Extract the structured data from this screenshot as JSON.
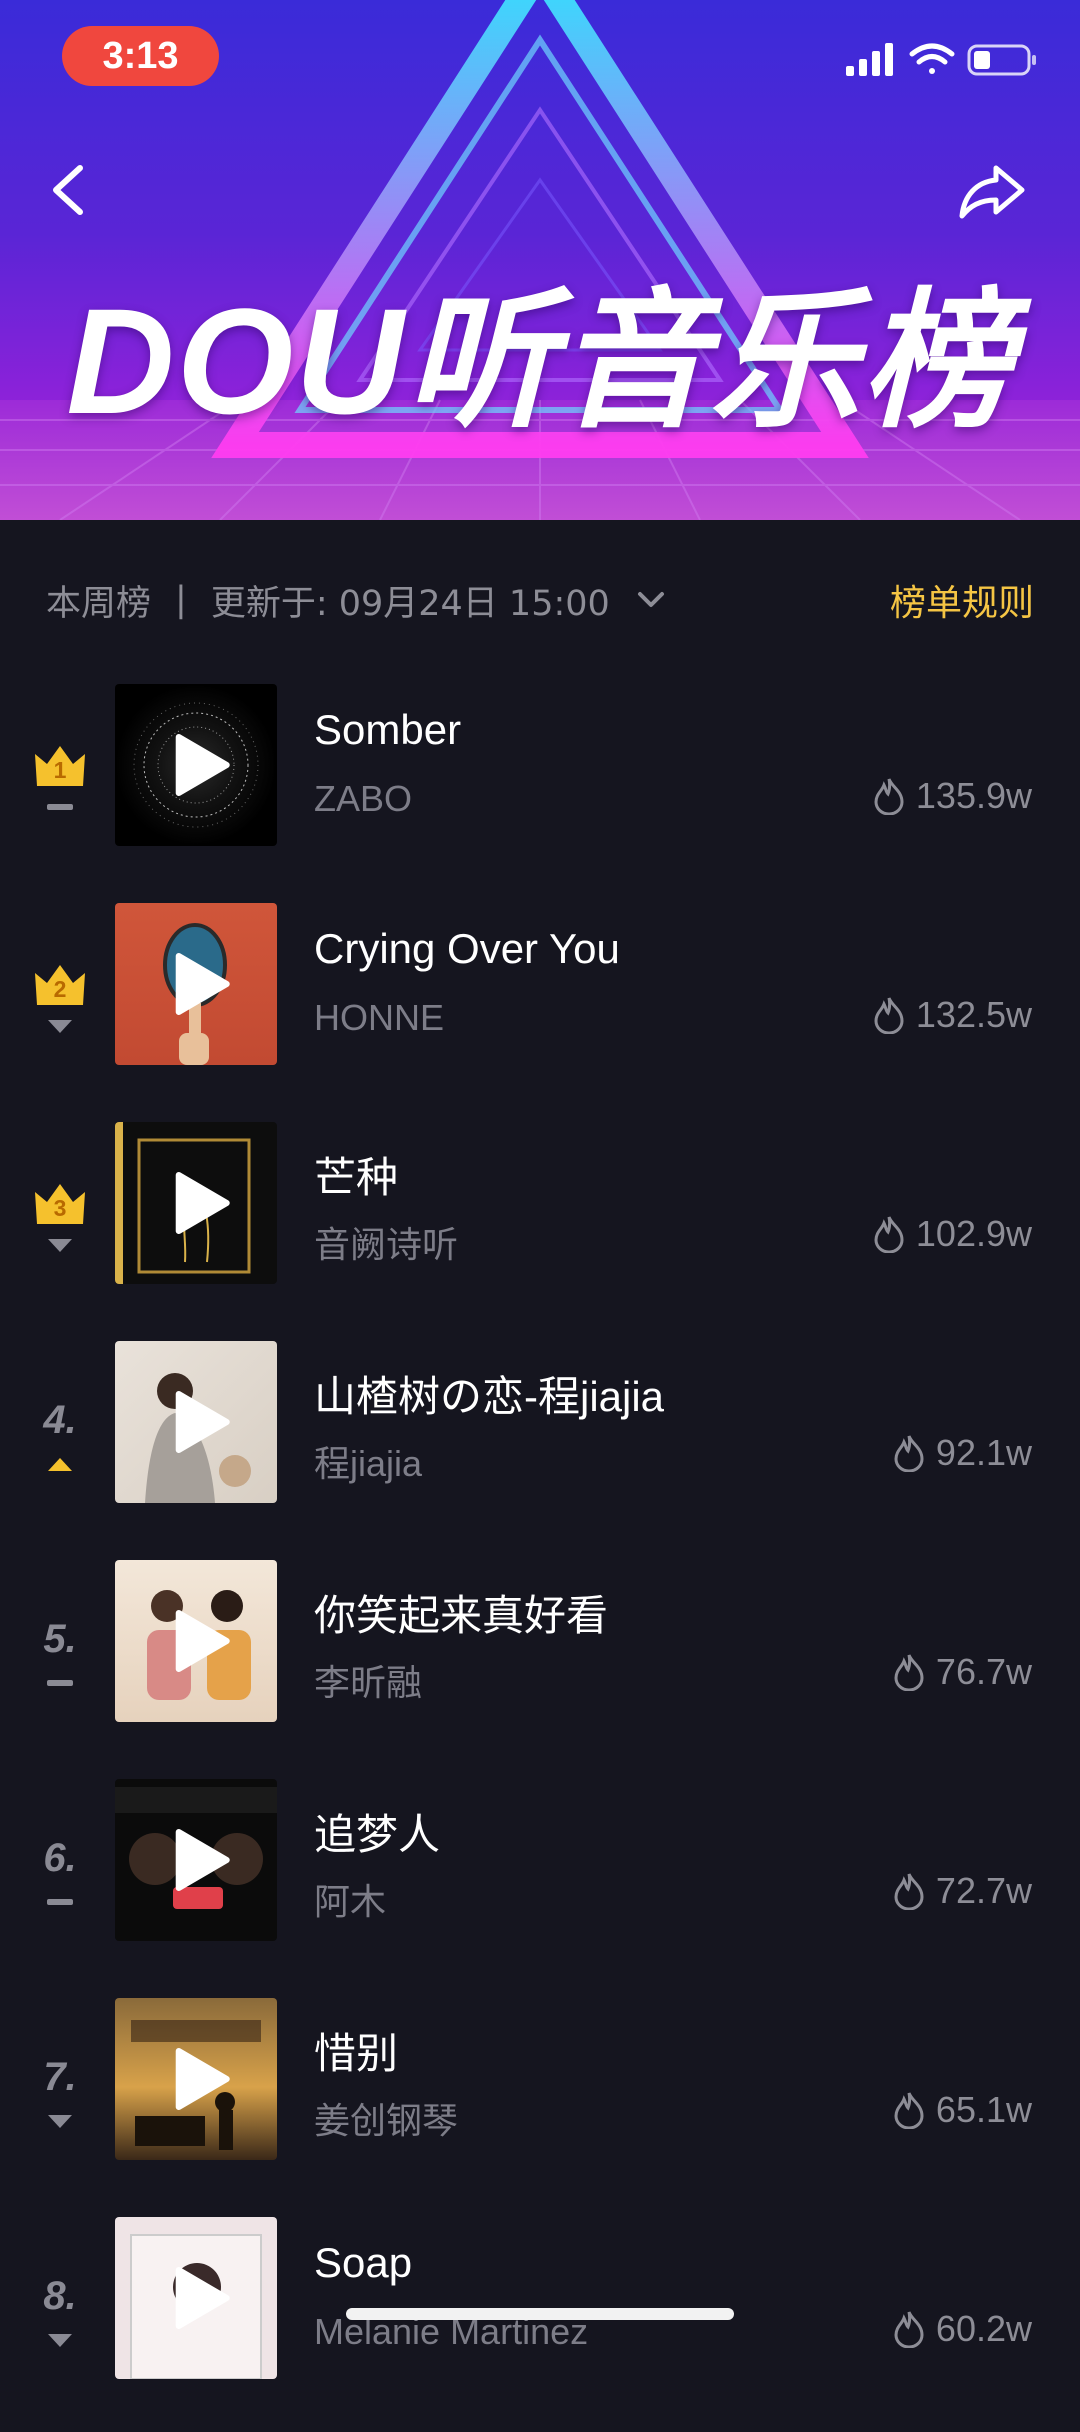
{
  "status_bar": {
    "time": "3:13"
  },
  "banner": {
    "title": "DOU听音乐榜"
  },
  "chart_info": {
    "period": "本周榜",
    "separator": "|",
    "updated": "更新于: 09月24日 15:00",
    "rules_link": "榜单规则"
  },
  "songs": [
    {
      "rank": "1",
      "trend": "same",
      "title": "Somber",
      "artist": "ZABO",
      "plays": "135.9w"
    },
    {
      "rank": "2",
      "trend": "down",
      "title": "Crying Over You",
      "artist": "HONNE",
      "plays": "132.5w"
    },
    {
      "rank": "3",
      "trend": "down",
      "title": "芒种",
      "artist": "音阙诗听",
      "plays": "102.9w"
    },
    {
      "rank": "4.",
      "trend": "up",
      "title": "山楂树の恋-程jiajia",
      "artist": "程jiajia",
      "plays": "92.1w"
    },
    {
      "rank": "5.",
      "trend": "same",
      "title": "你笑起来真好看",
      "artist": "李昕融",
      "plays": "76.7w"
    },
    {
      "rank": "6.",
      "trend": "same",
      "title": "追梦人",
      "artist": "阿木",
      "plays": "72.7w"
    },
    {
      "rank": "7.",
      "trend": "down",
      "title": "惜别",
      "artist": "姜创钢琴",
      "plays": "65.1w"
    },
    {
      "rank": "8.",
      "trend": "down",
      "title": "Soap",
      "artist": "Melanie Martinez",
      "plays": "60.2w"
    }
  ],
  "colors": {
    "accent": "#f5c544",
    "background": "#15151f",
    "crown": "#f5c12d",
    "up": "#f5c12d",
    "neutral": "#8a8a94"
  }
}
